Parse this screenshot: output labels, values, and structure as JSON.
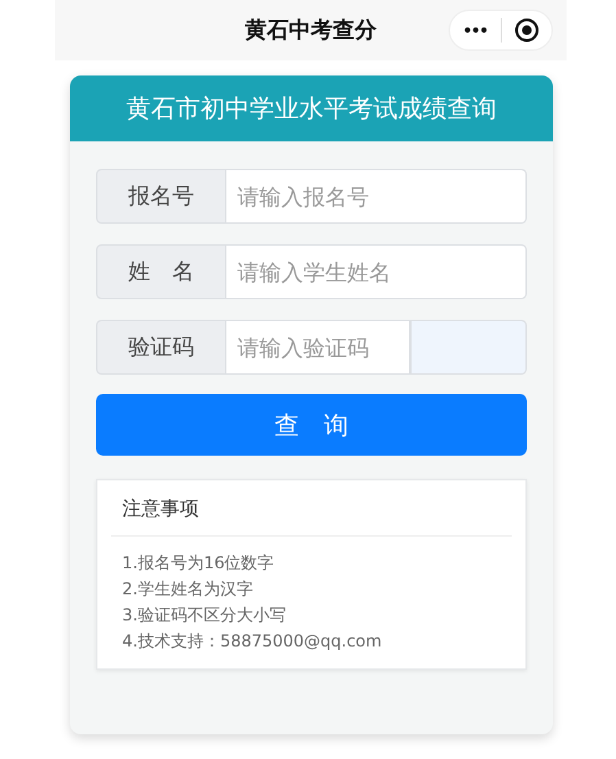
{
  "nav_bar": {
    "title": "黄石中考查分",
    "more_label": "•••"
  },
  "card": {
    "title": "黄石市初中学业水平考试成绩查询",
    "fields": [
      {
        "kind": "text",
        "label": "报名号",
        "placeholder": "请输入报名号"
      },
      {
        "kind": "text",
        "label": "姓　名",
        "placeholder": "请输入学生姓名"
      },
      {
        "kind": "captcha",
        "label": "验证码",
        "placeholder": "请输入验证码"
      }
    ],
    "submit_button": "查　询",
    "notes": {
      "title": "注意事项",
      "items": [
        "1.报名号为16位数字",
        "2.学生姓名为汉字",
        "3.验证码不区分大小写",
        "4.技术支持：58875000@qq.com"
      ]
    }
  }
}
